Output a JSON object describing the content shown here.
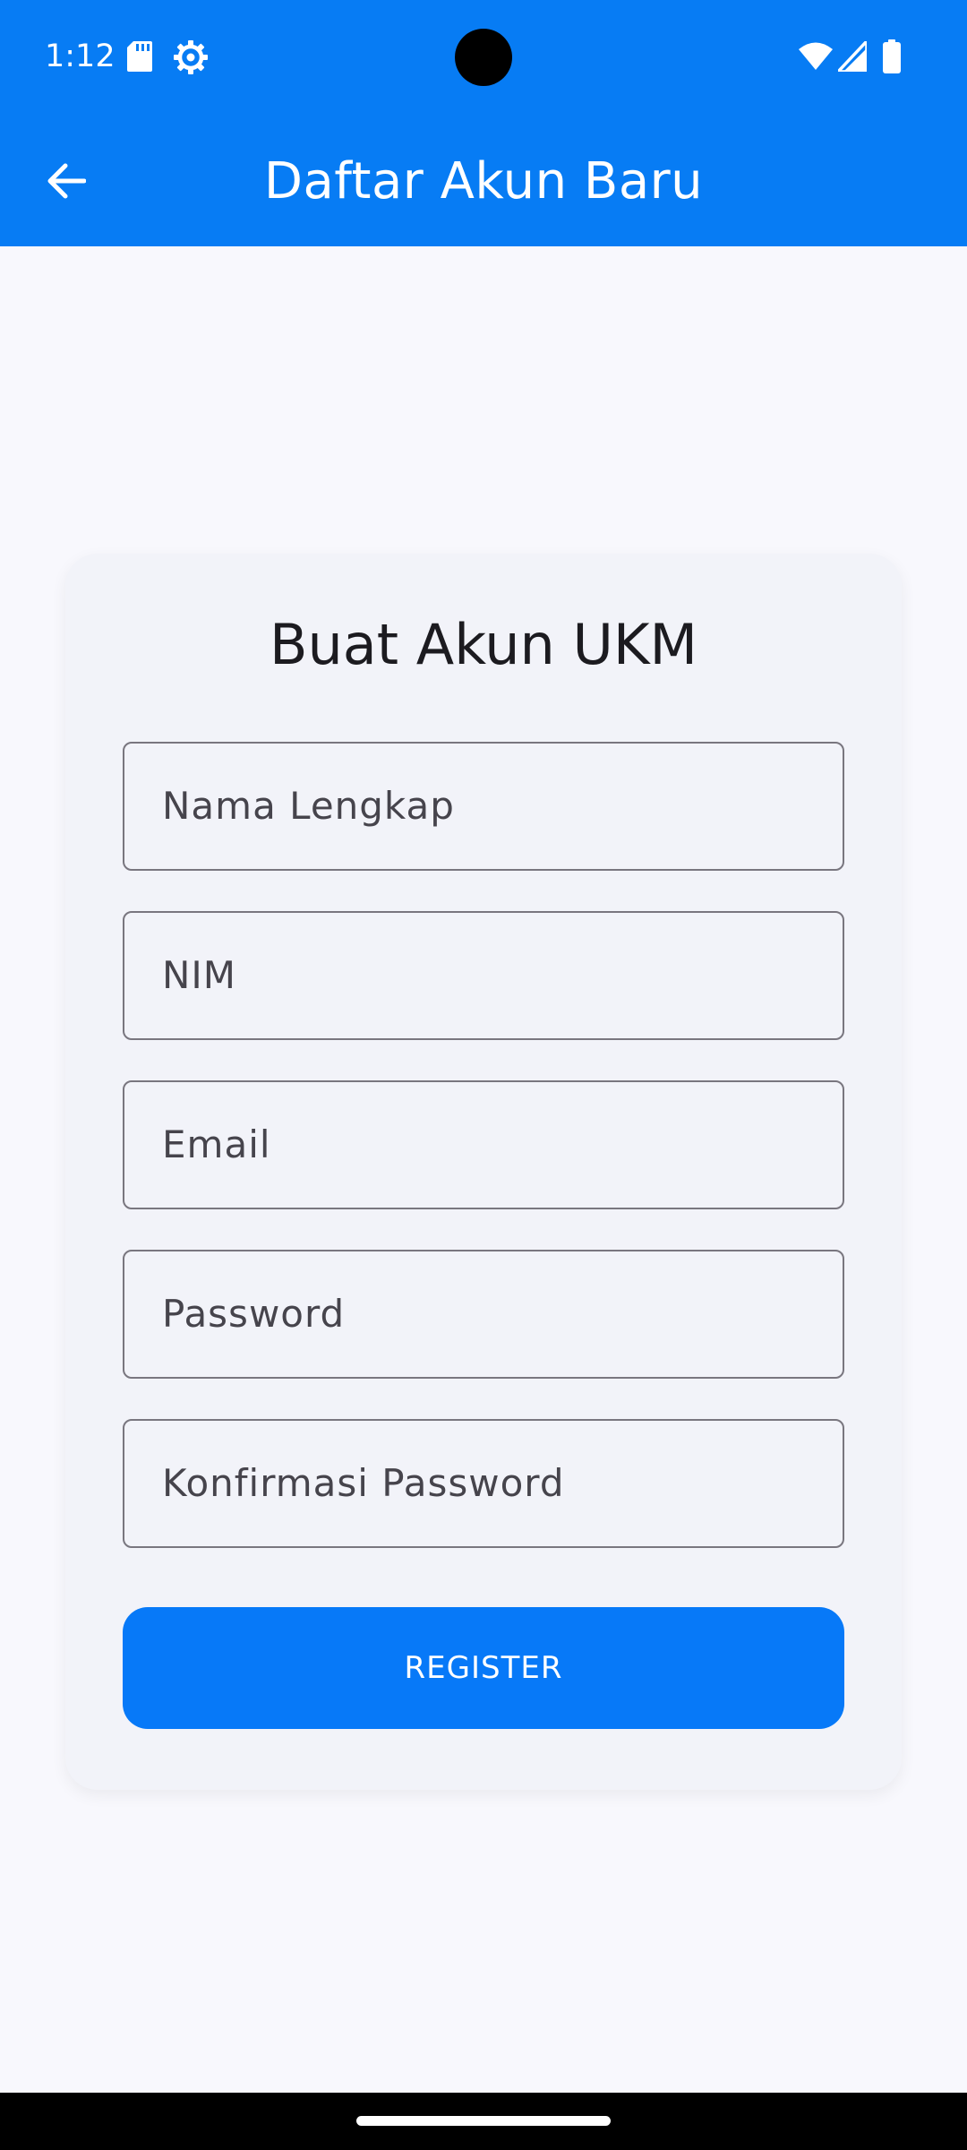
{
  "status_bar": {
    "time": "1:12",
    "icons": [
      "sd-card-icon",
      "settings-gear-icon",
      "wifi-icon",
      "signal-icon",
      "battery-icon"
    ]
  },
  "app_bar": {
    "title": "Daftar Akun Baru",
    "back_icon": "arrow-back-icon"
  },
  "form": {
    "title": "Buat Akun UKM",
    "fields": [
      {
        "label": "Nama Lengkap",
        "value": ""
      },
      {
        "label": "NIM",
        "value": ""
      },
      {
        "label": "Email",
        "value": ""
      },
      {
        "label": "Password",
        "value": ""
      },
      {
        "label": "Konfirmasi Password",
        "value": ""
      }
    ],
    "register_label": "REGISTER"
  },
  "colors": {
    "primary": "#077cf4",
    "background": "#f8f8fd",
    "card": "#f2f3f9",
    "field_border": "#79767f"
  }
}
